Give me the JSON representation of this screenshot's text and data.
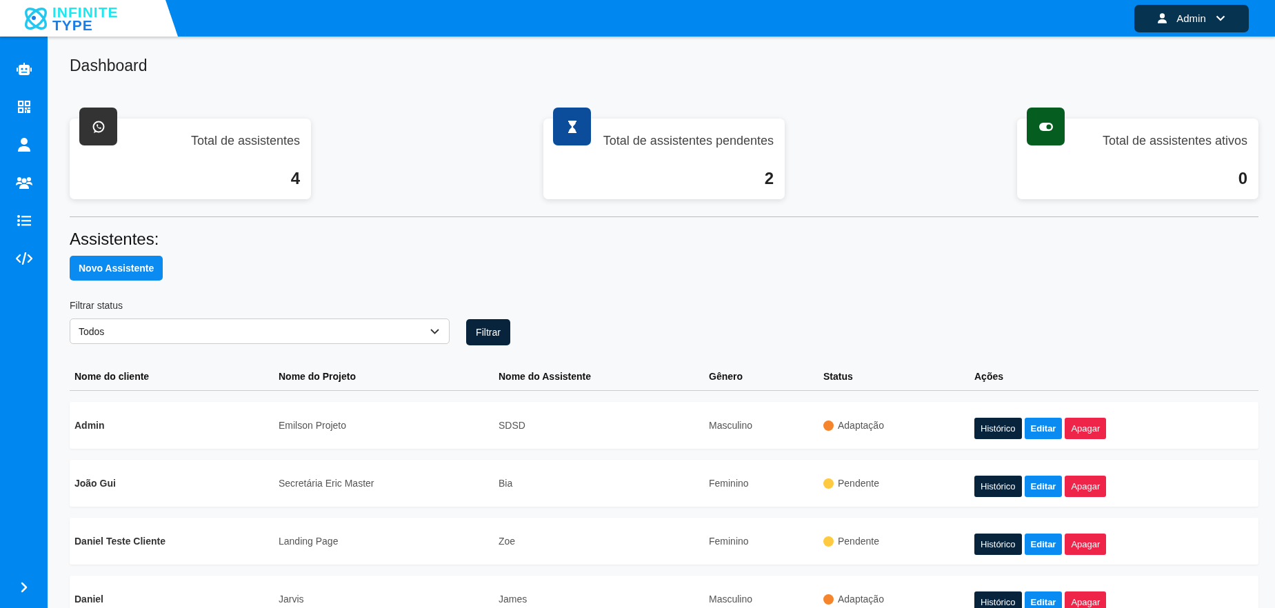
{
  "header": {
    "logo": {
      "line1": "INFINITE",
      "line2": "TYPE"
    },
    "user_menu": {
      "label": "Admin"
    }
  },
  "page_title": "Dashboard",
  "cards": [
    {
      "kind": "whatsapp",
      "title": "Total de assistentes",
      "value": "4"
    },
    {
      "kind": "hourglass",
      "title": "Total de assistentes pendentes",
      "value": "2"
    },
    {
      "kind": "toggle",
      "title": "Total de assistentes ativos",
      "value": "0"
    }
  ],
  "section_title": "Assistentes:",
  "new_button": "Novo Assistente",
  "filter": {
    "label": "Filtrar status",
    "value": "Todos",
    "button": "Filtrar"
  },
  "table": {
    "columns": [
      "Nome do cliente",
      "Nome do Projeto",
      "Nome do Assistente",
      "Gênero",
      "Status",
      "Ações"
    ],
    "rows": [
      {
        "client": "Admin",
        "project": "Emilson Projeto",
        "assistant": "SDSD",
        "gender": "Masculino",
        "status": {
          "label": "Adaptação",
          "color": "#f5842b"
        },
        "actions": [
          {
            "kind": "history",
            "label": "Histórico"
          },
          {
            "kind": "edit",
            "label": "Editar"
          },
          {
            "kind": "delete",
            "label": "Apagar"
          }
        ]
      },
      {
        "client": "João Gui",
        "project": "Secretária Eric Master",
        "assistant": "Bia",
        "gender": "Feminino",
        "status": {
          "label": "Pendente",
          "color": "#ffc940"
        },
        "actions": [
          {
            "kind": "history",
            "label": "Histórico"
          },
          {
            "kind": "edit",
            "label": "Editar"
          },
          {
            "kind": "delete",
            "label": "Apagar"
          }
        ]
      },
      {
        "client": "Daniel Teste Cliente",
        "project": "Landing Page",
        "assistant": "Zoe",
        "gender": "Feminino",
        "status": {
          "label": "Pendente",
          "color": "#ffc940"
        },
        "actions": [
          {
            "kind": "history",
            "label": "Histórico"
          },
          {
            "kind": "edit",
            "label": "Editar"
          },
          {
            "kind": "delete",
            "label": "Apagar"
          }
        ]
      },
      {
        "client": "Daniel",
        "project": "Jarvis",
        "assistant": "James",
        "gender": "Masculino",
        "status": {
          "label": "Adaptação",
          "color": "#f5842b"
        },
        "actions": [
          {
            "kind": "history",
            "label": "Histórico"
          },
          {
            "kind": "edit",
            "label": "Editar"
          },
          {
            "kind": "delete",
            "label": "Apagar"
          }
        ]
      }
    ]
  }
}
